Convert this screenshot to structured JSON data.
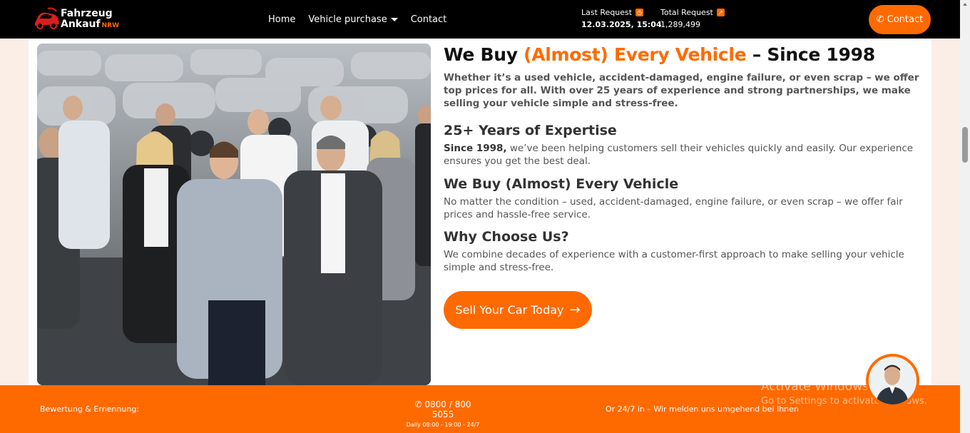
{
  "header": {
    "logo_line1": "Fahrzeug",
    "logo_line2": "Ankauf",
    "logo_suffix": "NRW",
    "nav": [
      {
        "label": "Home"
      },
      {
        "label": "Vehicle purchase"
      },
      {
        "label": "Contact"
      }
    ],
    "last_request": {
      "label": "Last Request",
      "value": "12.03.2025, 15:04"
    },
    "total_request": {
      "label": "Total Request",
      "value": "1,289,499"
    },
    "contact_button": "Contact"
  },
  "main": {
    "title_part1": "We Buy ",
    "title_accent": "(Almost) Every Vehicle",
    "title_part2": " – Since 1998",
    "intro": "Whether it’s a used vehicle, accident-damaged, engine failure, or even scrap – we offer top prices for all. With over 25 years of experience and strong partnerships, we make selling your vehicle simple and stress-free.",
    "sections": [
      {
        "heading": "25+ Years of Expertise",
        "bold_lead": "Since 1998,",
        "text": " we’ve been helping customers sell their vehicles quickly and easily. Our experience ensures you get the best deal."
      },
      {
        "heading": "We Buy (Almost) Every Vehicle",
        "text": "No matter the condition – used, accident-damaged, engine failure, or even scrap – we offer fair prices and hassle-free service."
      },
      {
        "heading": "Why Choose Us?",
        "text": "We combine decades of experience with a customer-first approach to make selling your vehicle simple and stress-free."
      }
    ],
    "cta": "Sell Your Car Today"
  },
  "footer": {
    "left": "Bewertung & Ernennung:",
    "phone": "0800 / 800 5055",
    "hours": "Daily 08:00 - 19:00 - 24/7",
    "right": "Or 24/7 in – Wir melden uns umgehend bei Ihnen"
  },
  "watermark": {
    "line1": "Activate Windows",
    "line2": "Go to Settings to activate Windows."
  },
  "colors": {
    "accent": "#ff6a00",
    "header_bg": "#000000",
    "page_bg": "#fbeee6"
  }
}
